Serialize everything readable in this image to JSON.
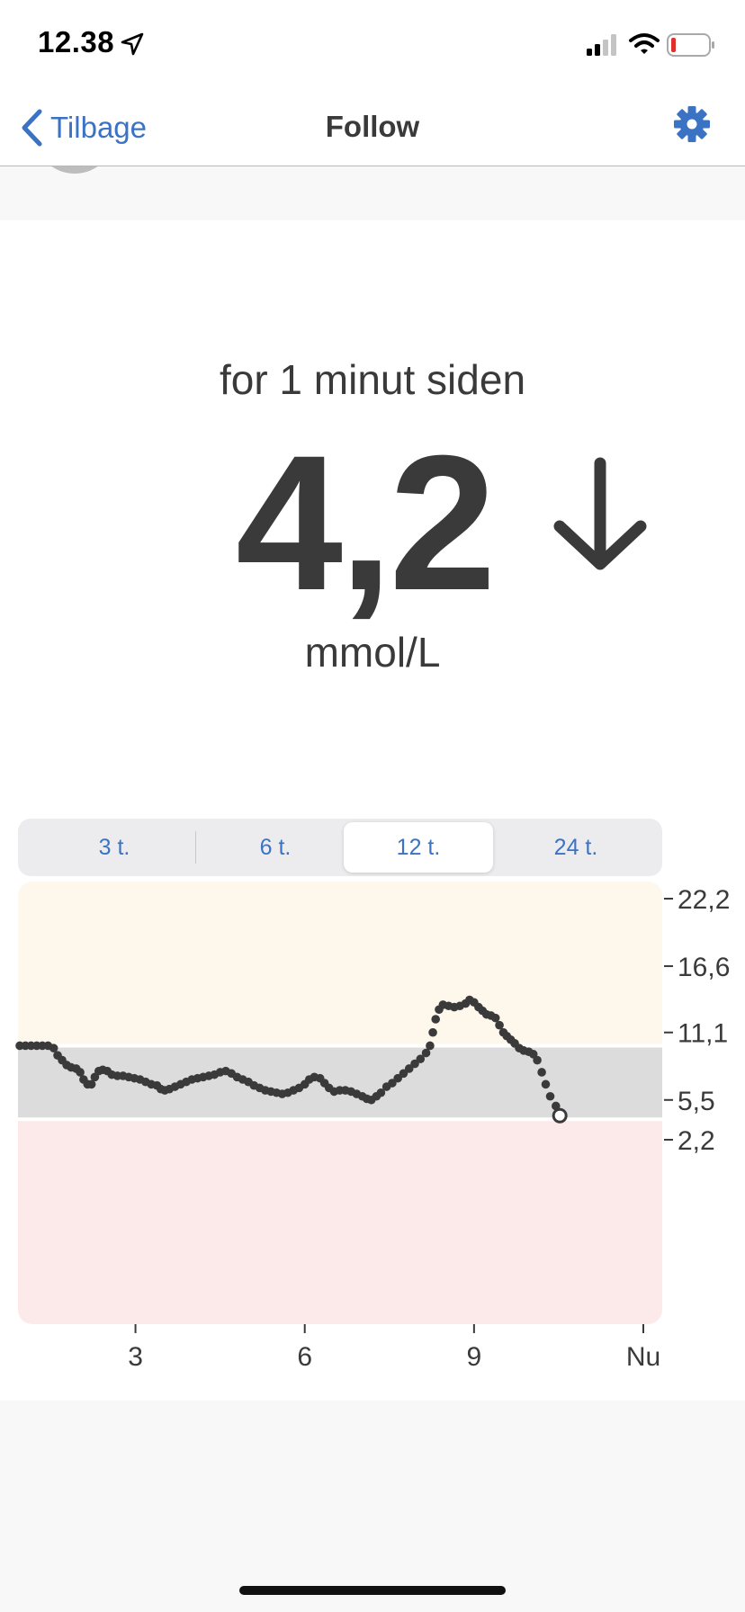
{
  "status_bar": {
    "time": "12.38"
  },
  "nav": {
    "back_label": "Tilbage",
    "title": "Follow"
  },
  "reading": {
    "last_update": "for 1 minut siden",
    "value": "4,2",
    "unit": "mmol/L",
    "trend": "falling"
  },
  "range_selector": {
    "options": [
      "3 t.",
      "6 t.",
      "12 t.",
      "24 t."
    ],
    "selected": "12 t."
  },
  "colors": {
    "accent": "#3b73c4",
    "high_zone": "#fdf7ec",
    "target_zone": "#dcdcdc",
    "low_zone": "#fce9e9",
    "trace": "#3a3a3a"
  },
  "chart_data": {
    "type": "scatter",
    "ylabel": "mmol/L",
    "y_ticks": [
      2.2,
      5.5,
      11.1,
      16.6,
      22.2
    ],
    "y_tick_labels": [
      "2,2",
      "5,5",
      "11,1",
      "16,6",
      "22,2"
    ],
    "x_ticks": [
      3,
      6,
      9,
      12
    ],
    "x_tick_labels": [
      "3",
      "6",
      "9",
      "Nu"
    ],
    "xlim": [
      0.95,
      12.3
    ],
    "ylim": [
      0,
      22.2
    ],
    "target_range": [
      3.9,
      10.0
    ],
    "x_unit": "hours",
    "points": [
      [
        0.95,
        10.0
      ],
      [
        1.05,
        10.0
      ],
      [
        1.15,
        10.0
      ],
      [
        1.25,
        10.0
      ],
      [
        1.35,
        10.0
      ],
      [
        1.45,
        10.0
      ],
      [
        1.55,
        9.8
      ],
      [
        1.62,
        9.2
      ],
      [
        1.7,
        8.8
      ],
      [
        1.78,
        8.4
      ],
      [
        1.86,
        8.2
      ],
      [
        1.95,
        8.1
      ],
      [
        2.02,
        7.8
      ],
      [
        2.08,
        7.2
      ],
      [
        2.15,
        6.8
      ],
      [
        2.22,
        6.8
      ],
      [
        2.28,
        7.4
      ],
      [
        2.35,
        7.9
      ],
      [
        2.42,
        8.0
      ],
      [
        2.5,
        7.9
      ],
      [
        2.58,
        7.6
      ],
      [
        2.68,
        7.5
      ],
      [
        2.78,
        7.5
      ],
      [
        2.88,
        7.4
      ],
      [
        2.98,
        7.3
      ],
      [
        3.08,
        7.2
      ],
      [
        3.18,
        7.0
      ],
      [
        3.28,
        6.8
      ],
      [
        3.38,
        6.7
      ],
      [
        3.45,
        6.4
      ],
      [
        3.52,
        6.3
      ],
      [
        3.6,
        6.4
      ],
      [
        3.7,
        6.6
      ],
      [
        3.8,
        6.8
      ],
      [
        3.9,
        7.0
      ],
      [
        4.0,
        7.2
      ],
      [
        4.1,
        7.3
      ],
      [
        4.2,
        7.4
      ],
      [
        4.3,
        7.5
      ],
      [
        4.4,
        7.6
      ],
      [
        4.5,
        7.8
      ],
      [
        4.6,
        7.9
      ],
      [
        4.7,
        7.7
      ],
      [
        4.8,
        7.4
      ],
      [
        4.9,
        7.2
      ],
      [
        5.0,
        7.0
      ],
      [
        5.1,
        6.7
      ],
      [
        5.2,
        6.5
      ],
      [
        5.3,
        6.3
      ],
      [
        5.4,
        6.2
      ],
      [
        5.5,
        6.1
      ],
      [
        5.6,
        6.0
      ],
      [
        5.7,
        6.1
      ],
      [
        5.8,
        6.3
      ],
      [
        5.9,
        6.5
      ],
      [
        6.0,
        6.8
      ],
      [
        6.08,
        7.2
      ],
      [
        6.17,
        7.4
      ],
      [
        6.27,
        7.3
      ],
      [
        6.35,
        6.9
      ],
      [
        6.43,
        6.5
      ],
      [
        6.52,
        6.2
      ],
      [
        6.62,
        6.3
      ],
      [
        6.72,
        6.3
      ],
      [
        6.82,
        6.2
      ],
      [
        6.92,
        6.0
      ],
      [
        7.02,
        5.8
      ],
      [
        7.1,
        5.6
      ],
      [
        7.18,
        5.5
      ],
      [
        7.27,
        5.8
      ],
      [
        7.35,
        6.1
      ],
      [
        7.45,
        6.6
      ],
      [
        7.55,
        6.9
      ],
      [
        7.65,
        7.3
      ],
      [
        7.75,
        7.7
      ],
      [
        7.85,
        8.1
      ],
      [
        7.95,
        8.5
      ],
      [
        8.05,
        8.9
      ],
      [
        8.15,
        9.4
      ],
      [
        8.22,
        10.0
      ],
      [
        8.27,
        11.1
      ],
      [
        8.32,
        12.2
      ],
      [
        8.38,
        13.0
      ],
      [
        8.45,
        13.4
      ],
      [
        8.55,
        13.3
      ],
      [
        8.65,
        13.2
      ],
      [
        8.75,
        13.3
      ],
      [
        8.85,
        13.5
      ],
      [
        8.92,
        13.8
      ],
      [
        9.0,
        13.6
      ],
      [
        9.08,
        13.2
      ],
      [
        9.15,
        12.9
      ],
      [
        9.22,
        12.6
      ],
      [
        9.3,
        12.5
      ],
      [
        9.38,
        12.3
      ],
      [
        9.45,
        11.7
      ],
      [
        9.52,
        11.1
      ],
      [
        9.58,
        10.8
      ],
      [
        9.65,
        10.5
      ],
      [
        9.72,
        10.2
      ],
      [
        9.8,
        9.8
      ],
      [
        9.88,
        9.6
      ],
      [
        9.97,
        9.5
      ],
      [
        10.05,
        9.3
      ],
      [
        10.12,
        8.8
      ],
      [
        10.2,
        7.8
      ],
      [
        10.27,
        6.8
      ],
      [
        10.35,
        5.8
      ],
      [
        10.45,
        5.0
      ],
      [
        10.52,
        4.2
      ]
    ],
    "current": [
      10.52,
      4.2
    ]
  }
}
